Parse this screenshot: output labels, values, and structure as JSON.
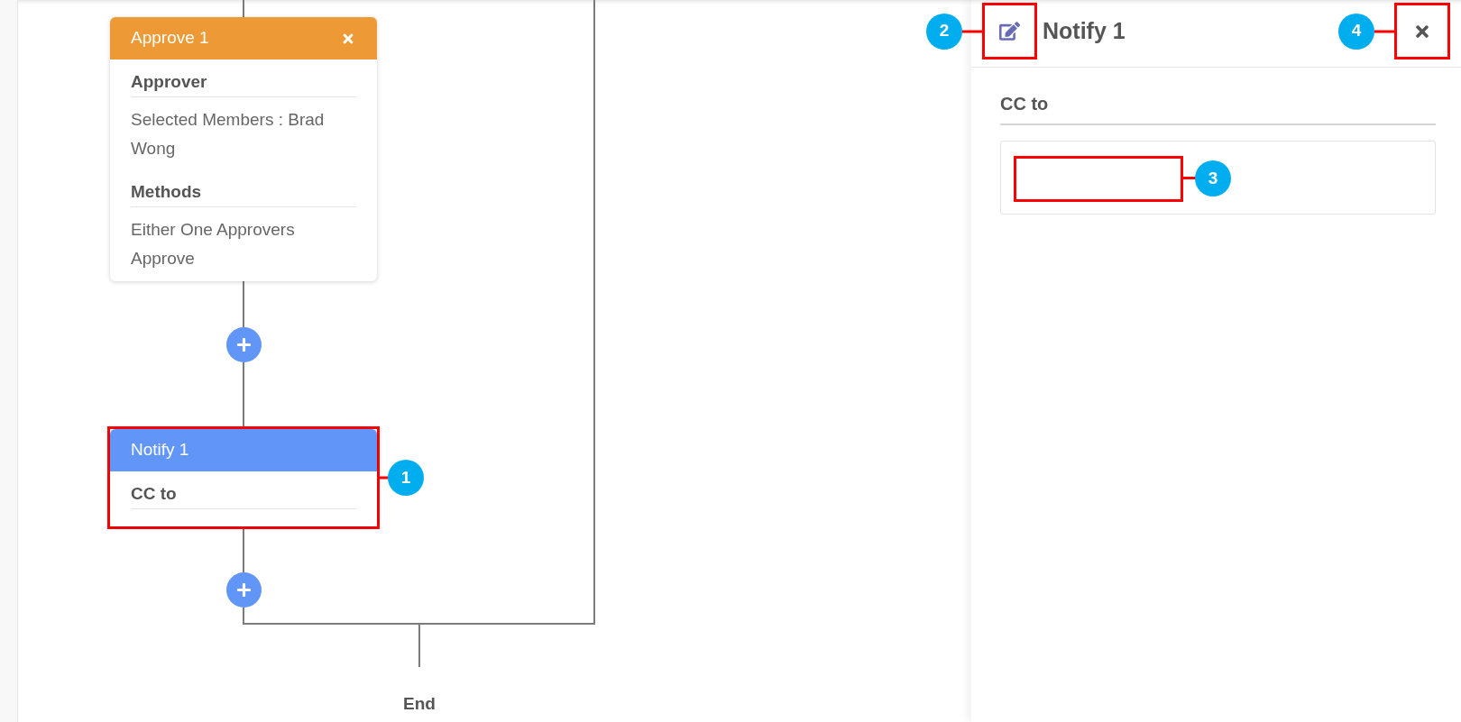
{
  "flow": {
    "nodes": [
      {
        "kind": "approval",
        "title": "Approve 1",
        "removable": true,
        "sections": [
          {
            "heading": "Approver",
            "value": "Selected Members : Brad Wong"
          },
          {
            "heading": "Methods",
            "value": "Either One Approvers Approve"
          }
        ]
      },
      {
        "kind": "notify",
        "title": "Notify 1",
        "removable": false,
        "callout": "1",
        "sections": [
          {
            "heading": "CC to"
          }
        ]
      }
    ],
    "end_label": "End"
  },
  "panel": {
    "title": "Notify 1",
    "edit_callout": "2",
    "close_callout": "4",
    "section_label": "CC to",
    "field_callout": "3"
  }
}
